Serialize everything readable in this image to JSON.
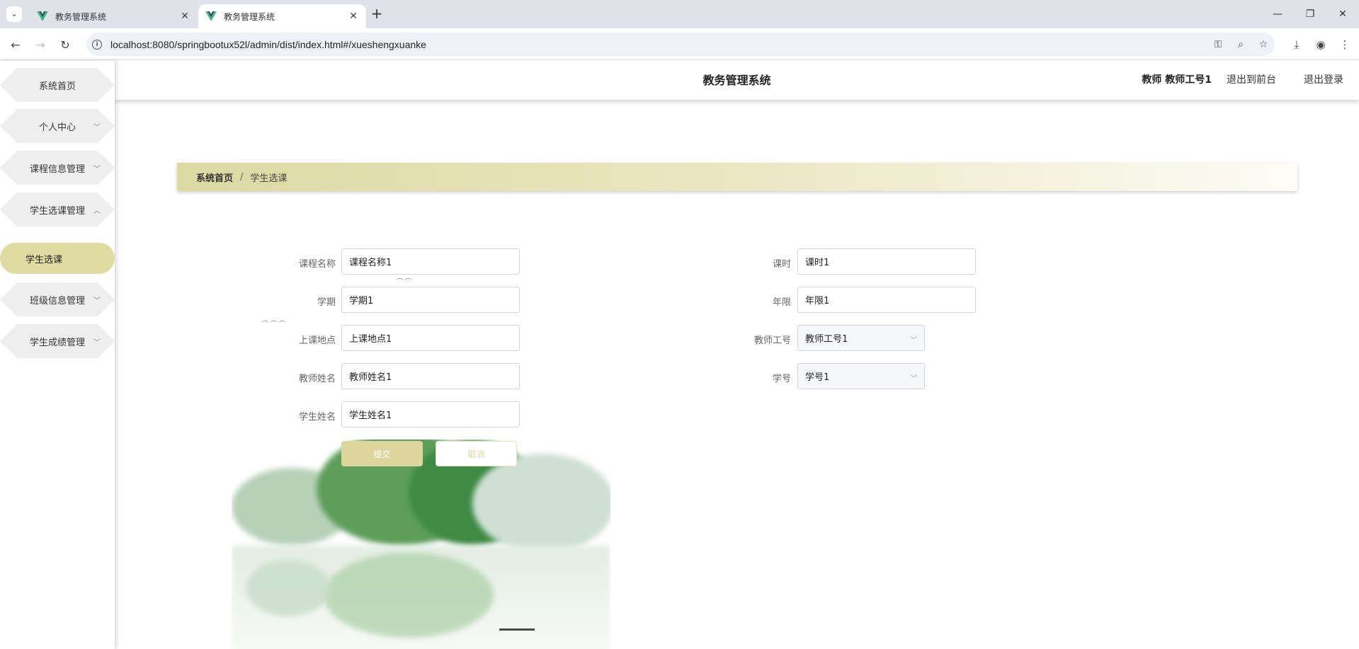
{
  "browser": {
    "tabs": [
      {
        "title": "教务管理系统",
        "active": false
      },
      {
        "title": "教务管理系统",
        "active": true
      }
    ],
    "url": "localhost:8080/springbootux52l/admin/dist/index.html#/xueshengxuanke"
  },
  "header": {
    "title": "教务管理系统",
    "user": "教师 教师工号1",
    "link_front": "退出到前台",
    "link_logout": "退出登录"
  },
  "sidebar": {
    "items": [
      {
        "label": "系统首页"
      },
      {
        "label": "个人中心",
        "chevron": "down"
      },
      {
        "label": "课程信息管理",
        "chevron": "down"
      },
      {
        "label": "学生选课管理",
        "chevron": "up"
      },
      {
        "label": "学生选课",
        "sub": true
      },
      {
        "label": "班级信息管理",
        "chevron": "down"
      },
      {
        "label": "学生成绩管理",
        "chevron": "down"
      }
    ]
  },
  "breadcrumb": {
    "home": "系统首页",
    "separator": "/",
    "current": "学生选课"
  },
  "form": {
    "course_name": {
      "label": "课程名称",
      "value": "课程名称1"
    },
    "hours": {
      "label": "课时",
      "value": "课时1"
    },
    "term": {
      "label": "学期",
      "value": "学期1"
    },
    "years": {
      "label": "年限",
      "value": "年限1"
    },
    "location": {
      "label": "上课地点",
      "value": "上课地点1"
    },
    "teacher_id": {
      "label": "教师工号",
      "value": "教师工号1"
    },
    "teacher_name": {
      "label": "教师姓名",
      "value": "教师姓名1"
    },
    "student_id": {
      "label": "学号",
      "value": "学号1"
    },
    "student_name": {
      "label": "学生姓名",
      "value": "学生姓名1"
    },
    "submit_label": "提交",
    "cancel_label": "取消"
  },
  "colors": {
    "accent": "#dcd59d",
    "active_menu": "#e0dba3"
  }
}
